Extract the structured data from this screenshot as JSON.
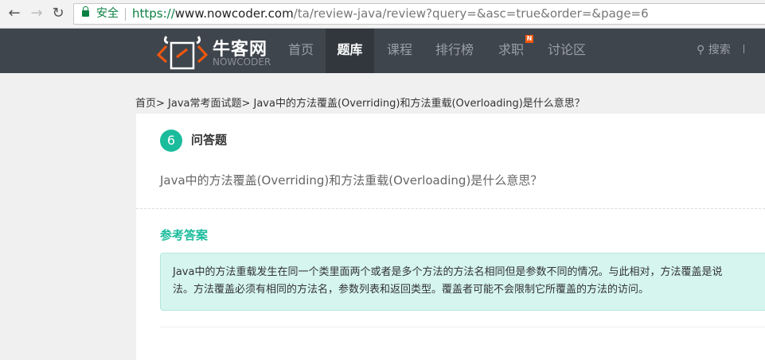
{
  "browser": {
    "secure_label": "安全",
    "url_scheme": "https://",
    "url_host": "www.nowcoder.com",
    "url_path": "/ta/review-java/review?query=&asc=true&order=&page=6"
  },
  "nav": {
    "logo_cn": "牛客网",
    "logo_en": "NOWCODER",
    "items": [
      "首页",
      "题库",
      "课程",
      "排行榜",
      "求职",
      "讨论区"
    ],
    "active": "题库",
    "badge": "N",
    "search": "搜索"
  },
  "breadcrumb": "首页> Java常考面试题> Java中的方法覆盖(Overriding)和方法重载(Overloading)是什么意思？",
  "question": {
    "number": "6",
    "type": "问答题",
    "text": "Java中的方法覆盖(Overriding)和方法重载(Overloading)是什么意思？"
  },
  "answer": {
    "title": "参考答案",
    "line1": "Java中的方法重载发生在同一个类里面两个或者是多个方法的方法名相同但是参数不同的情况。与此相对，方法覆盖是说",
    "line2": "法。方法覆盖必须有相同的方法名，参数列表和返回类型。覆盖者可能不会限制它所覆盖的方法的访问。"
  },
  "colors": {
    "accent": "#1abc9c",
    "nav_bg": "#3f454d",
    "badge": "#f5570c"
  }
}
